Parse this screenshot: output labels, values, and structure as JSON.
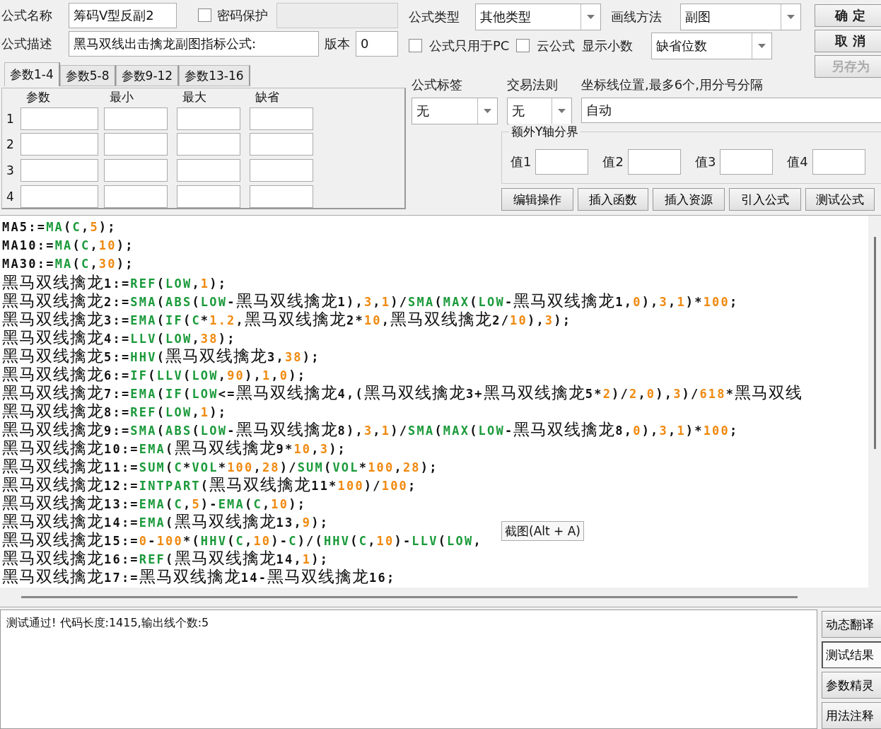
{
  "formula_name": {
    "label": "公式名称",
    "value": "筹码V型反副2"
  },
  "password_protect": {
    "label": "密码保护",
    "checked": false
  },
  "description": {
    "label": "公式描述",
    "value": "黑马双线出击擒龙副图指标公式:"
  },
  "version": {
    "label": "版本",
    "value": "0"
  },
  "formula_type": {
    "label": "公式类型",
    "value": "其他类型"
  },
  "draw_method": {
    "label": "画线方法",
    "value": "副图"
  },
  "options": [
    {
      "label": "公式只用于PC",
      "checked": false
    },
    {
      "label": "云公式",
      "checked": false
    }
  ],
  "show_decimals": {
    "label": "显示小数",
    "value": "缺省位数"
  },
  "dialog_buttons": [
    {
      "label": "确 定",
      "disabled": false
    },
    {
      "label": "取 消",
      "disabled": false
    },
    {
      "label": "另存为",
      "disabled": true
    }
  ],
  "param_tabs": [
    {
      "label": "参数1-4",
      "selected": true
    },
    {
      "label": "参数5-8",
      "selected": false
    },
    {
      "label": "参数9-12",
      "selected": false
    },
    {
      "label": "参数13-16",
      "selected": false
    }
  ],
  "param_table": {
    "columns": [
      "参数",
      "最小",
      "最大",
      "缺省"
    ],
    "rows": [
      "1",
      "2",
      "3",
      "4"
    ]
  },
  "formula_tag": {
    "label": "公式标签",
    "value": "无"
  },
  "trade_rule": {
    "label": "交易法则",
    "value": "无"
  },
  "axis_lines": {
    "label": "坐标线位置,最多6个,用分号分隔",
    "value": "自动"
  },
  "extra_y": {
    "title": "额外Y轴分界",
    "values": [
      "值1",
      "值2",
      "值3",
      "值4"
    ]
  },
  "action_buttons": [
    "编辑操作",
    "插入函数",
    "插入资源",
    "引入公式",
    "测试公式"
  ],
  "code_lines": [
    "MA5:=MA(C,5);",
    "MA10:=MA(C,10);",
    "MA30:=MA(C,30);",
    "黑马双线擒龙1:=REF(LOW,1);",
    "黑马双线擒龙2:=SMA(ABS(LOW-黑马双线擒龙1),3,1)/SMA(MAX(LOW-黑马双线擒龙1,0),3,1)*100;",
    "黑马双线擒龙3:=EMA(IF(C*1.2,黑马双线擒龙2*10,黑马双线擒龙2/10),3);",
    "黑马双线擒龙4:=LLV(LOW,38);",
    "黑马双线擒龙5:=HHV(黑马双线擒龙3,38);",
    "黑马双线擒龙6:=IF(LLV(LOW,90),1,0);",
    "黑马双线擒龙7:=EMA(IF(LOW<=黑马双线擒龙4,(黑马双线擒龙3+黑马双线擒龙5*2)/2,0),3)/618*黑马双线",
    "黑马双线擒龙8:=REF(LOW,1);",
    "黑马双线擒龙9:=SMA(ABS(LOW-黑马双线擒龙8),3,1)/SMA(MAX(LOW-黑马双线擒龙8,0),3,1)*100;",
    "黑马双线擒龙10:=EMA(黑马双线擒龙9*10,3);",
    "黑马双线擒龙11:=SUM(C*VOL*100,28)/SUM(VOL*100,28);",
    "黑马双线擒龙12:=INTPART(黑马双线擒龙11*100)/100;",
    "黑马双线擒龙13:=EMA(C,5)-EMA(C,10);",
    "黑马双线擒龙14:=EMA(黑马双线擒龙13,9);",
    "黑马双线擒龙15:=0-100*(HHV(C,10)-C)/(HHV(C,10)-LLV(LOW,",
    "黑马双线擒龙16:=REF(黑马双线擒龙14,1);",
    "黑马双线擒龙17:=黑马双线擒龙14-黑马双线擒龙16;"
  ],
  "tooltip": "截图(Alt + A)",
  "result_text": "测试通过! 代码长度:1415,输出线个数:5",
  "side_buttons": [
    {
      "label": "动态翻译",
      "selected": false
    },
    {
      "label": "测试结果",
      "selected": true
    },
    {
      "label": "参数精灵",
      "selected": false
    },
    {
      "label": "用法注释",
      "selected": false
    }
  ]
}
